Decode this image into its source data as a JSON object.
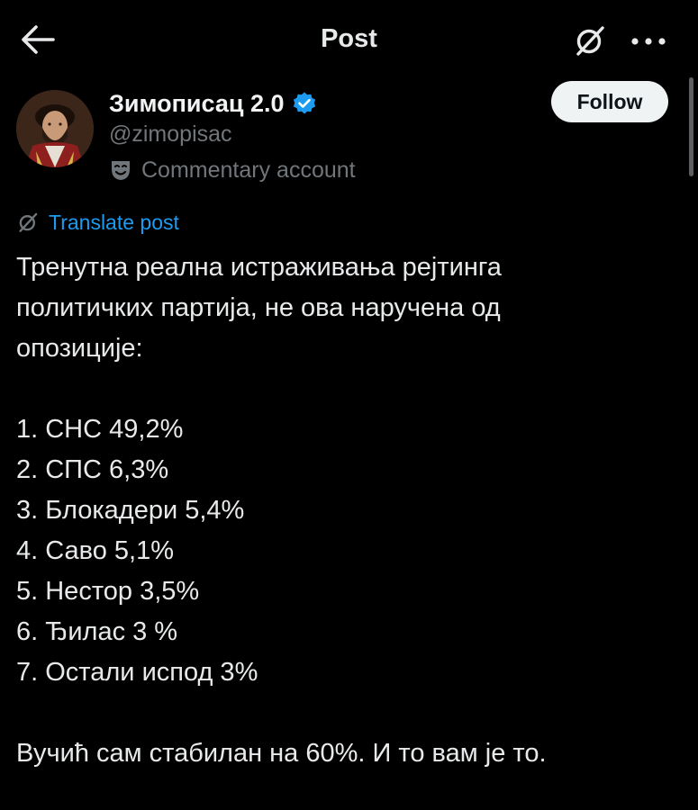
{
  "header": {
    "title": "Post",
    "back_icon": "arrow-left-icon",
    "grok_icon": "grok-icon",
    "more_icon": "more-horizontal-icon"
  },
  "author": {
    "display_name": "Зимописац 2.0",
    "handle": "@zimopisac",
    "verified_icon": "verified-badge-icon",
    "label_icon": "theater-masks-icon",
    "label": "Commentary account",
    "follow_label": "Follow"
  },
  "translate": {
    "icon": "grok-icon",
    "label": "Translate post"
  },
  "post": {
    "intro_lines": [
      "Тренутна реална истраживања рејтинга",
      "политичких партија, не ова наручена од",
      "опозиције:"
    ],
    "ranking": [
      "1. СНС 49,2%",
      "2. СПС 6,3%",
      "3. Блокадери 5,4%",
      "4. Саво 5,1%",
      "5. Нестор 3,5%",
      "6. Ђилас 3 %",
      "7. Остали испод 3%"
    ],
    "closing": "Вучић сам стабилан на 60%. И то вам је то."
  },
  "colors": {
    "background": "#000000",
    "text_primary": "#e7e9ea",
    "text_secondary": "#71767b",
    "accent": "#1d9bf0",
    "follow_bg": "#eff3f4"
  }
}
